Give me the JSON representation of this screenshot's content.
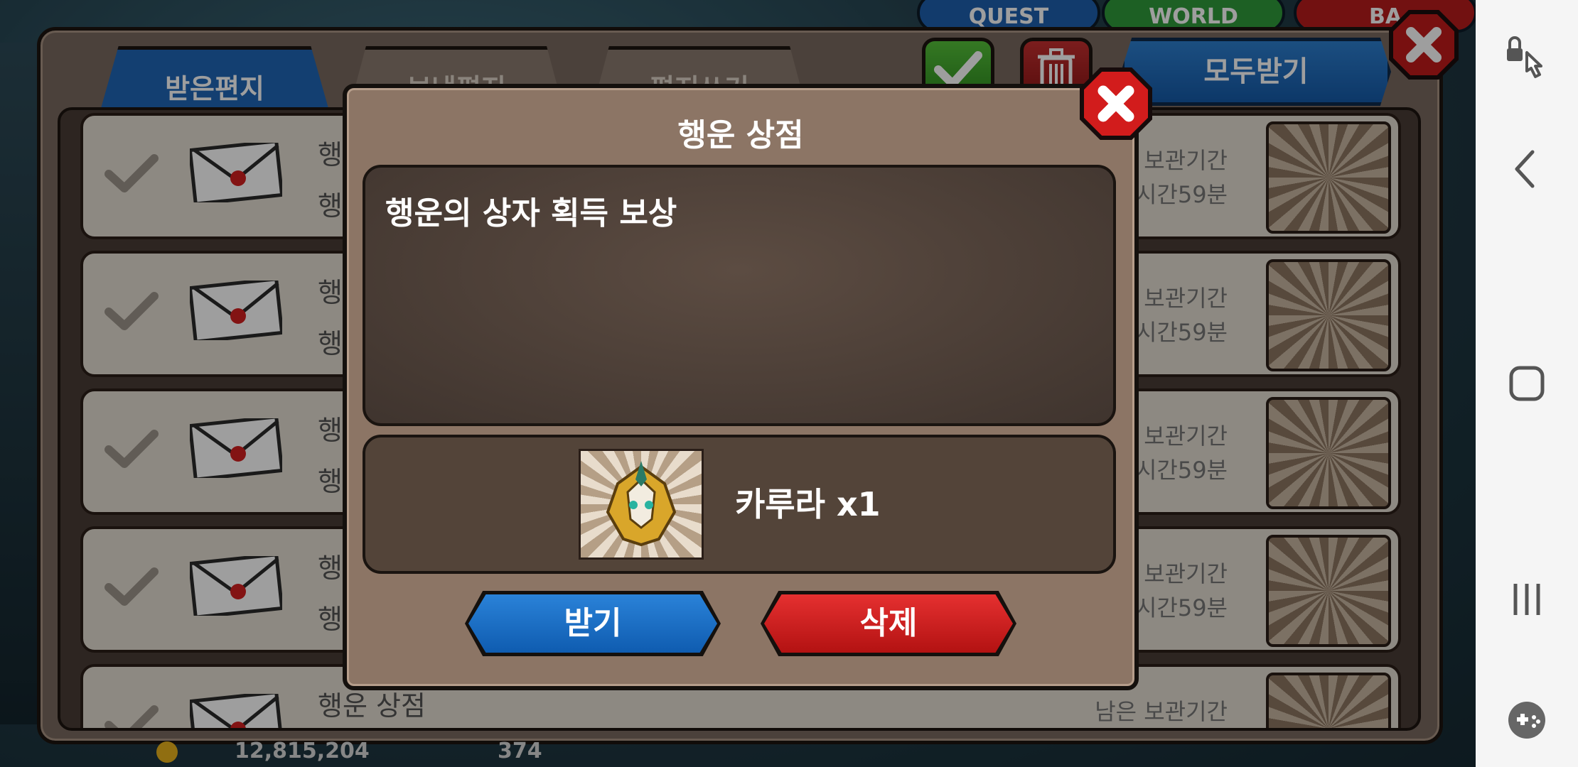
{
  "top_tabs": [
    "QUEST",
    "WORLD",
    "BA"
  ],
  "mailbox": {
    "tabs": [
      {
        "label": "받은편지"
      },
      {
        "label": "보낸편지"
      },
      {
        "label": "편지쓰기"
      }
    ],
    "receive_all_label": "모두받기",
    "rows": [
      {
        "sender": "행",
        "title": "행",
        "expiry_line1": "보관기간",
        "expiry_line2": "시간59분",
        "item_icon": "karura-mask-icon"
      },
      {
        "sender": "행",
        "title": "행",
        "expiry_line1": "보관기간",
        "expiry_line2": "시간59분",
        "item_icon": "potion-icon"
      },
      {
        "sender": "행",
        "title": "행",
        "expiry_line1": "보관기간",
        "expiry_line2": "시간59분",
        "item_icon": "hammer-icon"
      },
      {
        "sender": "행",
        "title": "행",
        "expiry_line1": "보관기간",
        "expiry_line2": "시간59분",
        "item_icon": "egg-icon"
      },
      {
        "sender": "행운 상점",
        "title": "",
        "expiry_line1": "남은 보관기간",
        "expiry_line2": "",
        "item_icon": "meat-icon"
      }
    ]
  },
  "bottom_bar": {
    "gold": "12,815,204",
    "gems": "374"
  },
  "dialog": {
    "title": "행운 상점",
    "message": "행운의 상자 획득 보상",
    "reward_text": "카루라 x1",
    "reward_icon": "karura-mask-icon",
    "receive_label": "받기",
    "delete_label": "삭제"
  },
  "colors": {
    "primary_button": "#1f67b6",
    "danger_button": "#c81d1d",
    "dialog_bg": "#8c7565"
  },
  "navbar": {
    "icons": [
      "accessibility-lock-icon",
      "back-icon",
      "home-icon",
      "recents-icon",
      "game-tools-icon"
    ]
  }
}
